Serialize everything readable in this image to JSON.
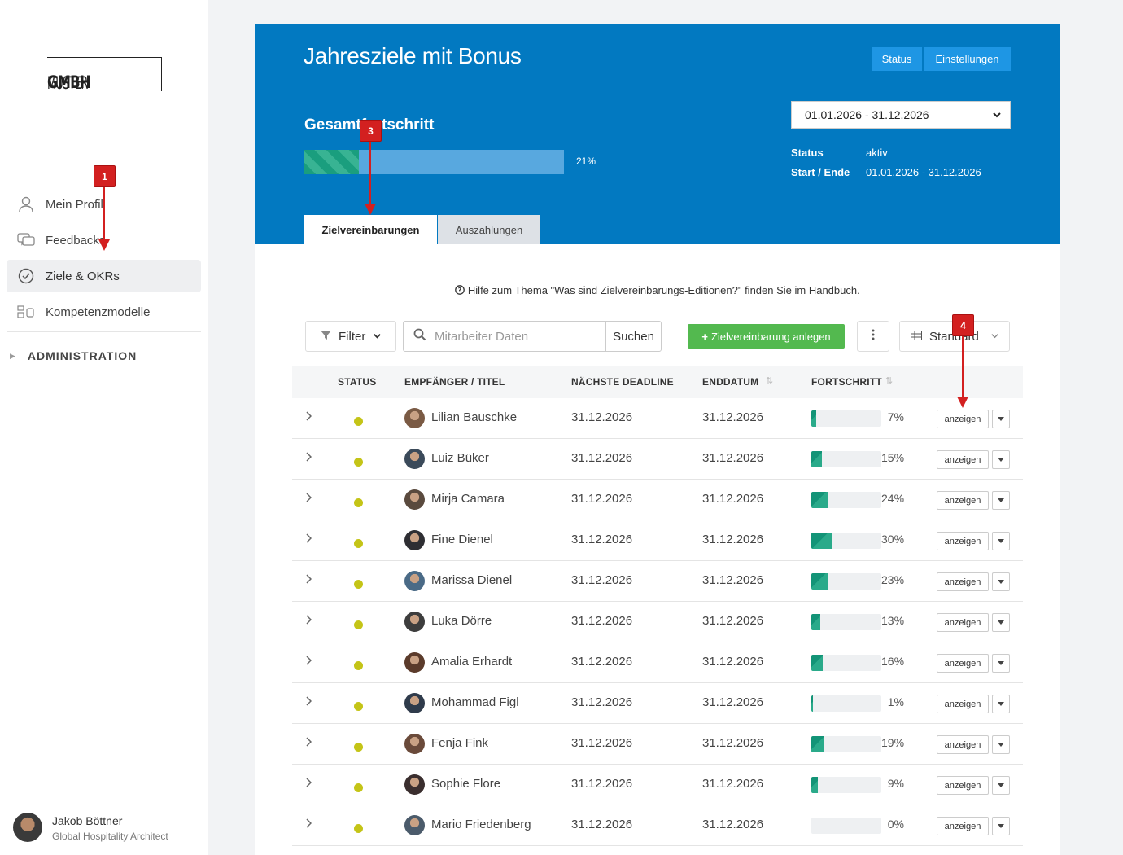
{
  "sidebar": {
    "logo_part1": "MUSTER",
    "logo_part2": "GMBH",
    "items": [
      {
        "label": "Mein Profil",
        "icon": "user-icon"
      },
      {
        "label": "Feedbacks",
        "icon": "chat-icon"
      },
      {
        "label": "Ziele & OKRs",
        "icon": "check-circle-icon"
      },
      {
        "label": "Kompetenzmodelle",
        "icon": "shapes-icon"
      }
    ],
    "admin_label": "ADMINISTRATION",
    "user": {
      "name": "Jakob Böttner",
      "role": "Global Hospitality Architect"
    }
  },
  "header": {
    "title": "Jahresziele mit Bonus",
    "status_button": "Status",
    "settings_button": "Einstellungen",
    "date_range": "01.01.2026 - 31.12.2026",
    "status_label": "Status",
    "status_value": "aktiv",
    "start_end_label": "Start / Ende",
    "start_end_value": "01.01.2026 - 31.12.2026",
    "progress_title": "Gesamtfortschritt",
    "progress_pct": "21%",
    "progress_value": 0.21,
    "tabs": [
      "Zielvereinbarungen",
      "Auszahlungen"
    ]
  },
  "help_text": "Hilfe zum Thema \"Was sind Zielvereinbarungs-Editionen?\" finden Sie im Handbuch.",
  "toolbar": {
    "filter_label": "Filter",
    "search_placeholder": "Mitarbeiter Daten",
    "search_button": "Suchen",
    "create_label": "Zielvereinbarung anlegen",
    "view_label": "Standard"
  },
  "table": {
    "headers": [
      "STATUS",
      "EMPFÄNGER / TITEL",
      "NÄCHSTE DEADLINE",
      "ENDDATUM",
      "FORTSCHRITT"
    ],
    "show_label": "anzeigen",
    "rows": [
      {
        "name": "Lilian Bauschke",
        "deadline": "31.12.2026",
        "end": "31.12.2026",
        "pct": "7%",
        "value": 0.07
      },
      {
        "name": "Luiz Büker",
        "deadline": "31.12.2026",
        "end": "31.12.2026",
        "pct": "15%",
        "value": 0.15
      },
      {
        "name": "Mirja Camara",
        "deadline": "31.12.2026",
        "end": "31.12.2026",
        "pct": "24%",
        "value": 0.24
      },
      {
        "name": "Fine Dienel",
        "deadline": "31.12.2026",
        "end": "31.12.2026",
        "pct": "30%",
        "value": 0.3
      },
      {
        "name": "Marissa Dienel",
        "deadline": "31.12.2026",
        "end": "31.12.2026",
        "pct": "23%",
        "value": 0.23
      },
      {
        "name": "Luka Dörre",
        "deadline": "31.12.2026",
        "end": "31.12.2026",
        "pct": "13%",
        "value": 0.13
      },
      {
        "name": "Amalia Erhardt",
        "deadline": "31.12.2026",
        "end": "31.12.2026",
        "pct": "16%",
        "value": 0.16
      },
      {
        "name": "Mohammad Figl",
        "deadline": "31.12.2026",
        "end": "31.12.2026",
        "pct": "1%",
        "value": 0.01
      },
      {
        "name": "Fenja Fink",
        "deadline": "31.12.2026",
        "end": "31.12.2026",
        "pct": "19%",
        "value": 0.19
      },
      {
        "name": "Sophie Flore",
        "deadline": "31.12.2026",
        "end": "31.12.2026",
        "pct": "9%",
        "value": 0.09
      },
      {
        "name": "Mario Friedenberg",
        "deadline": "31.12.2026",
        "end": "31.12.2026",
        "pct": "0%",
        "value": 0.0
      }
    ]
  },
  "annotations": [
    "1",
    "3",
    "4"
  ],
  "colors": {
    "header_blue": "#0279c1",
    "accent_green": "#53b94f",
    "progress_teal": "#139477",
    "status_dot": "#c4c417",
    "annotation_red": "#d32020"
  }
}
